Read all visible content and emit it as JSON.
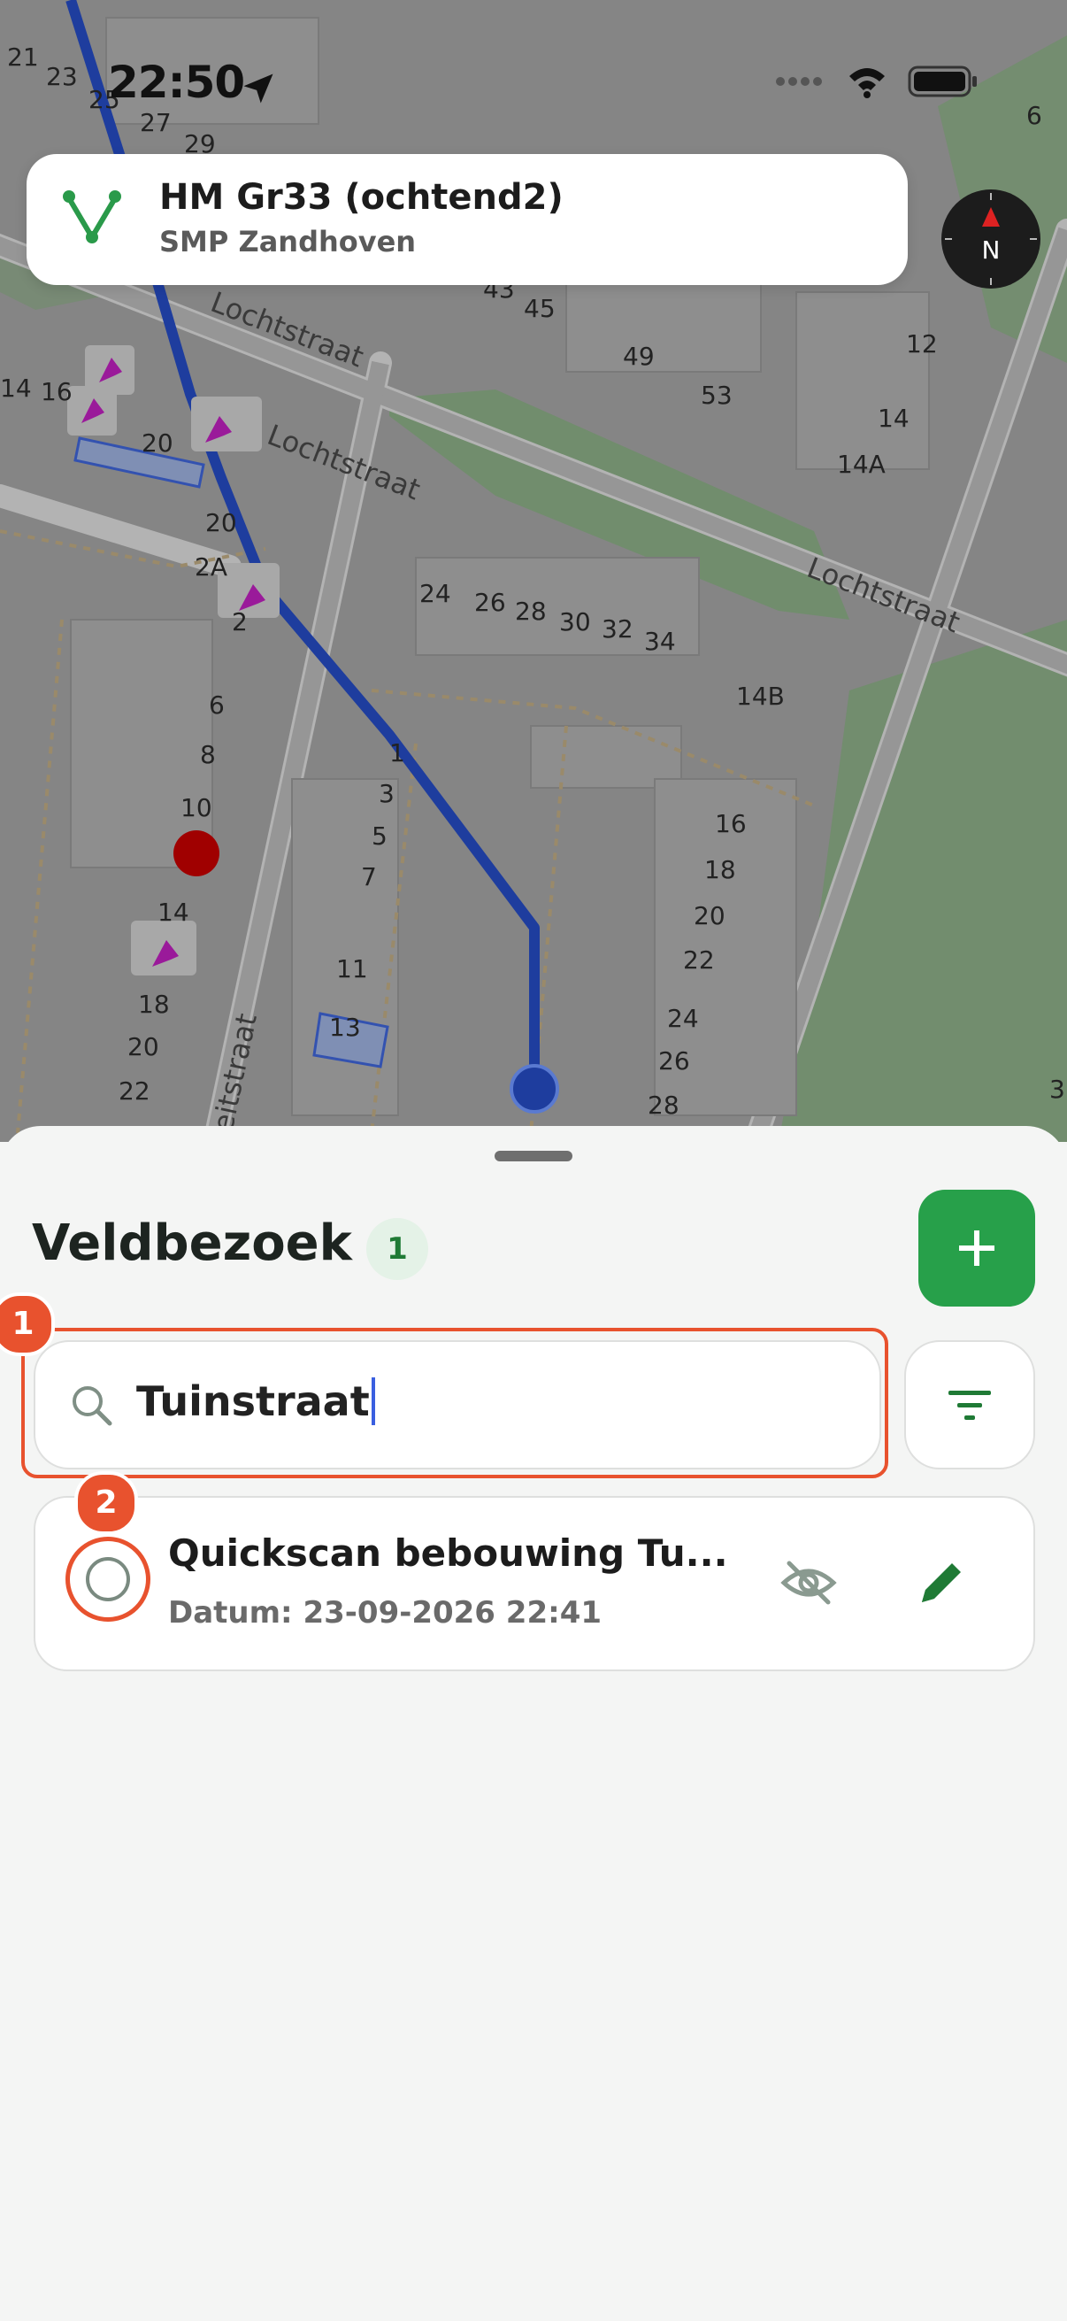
{
  "status": {
    "time": "22:50"
  },
  "route": {
    "title": "HM Gr33 (ochtend2)",
    "subtitle": "SMP Zandhoven"
  },
  "compass": {
    "letter": "N"
  },
  "map": {
    "house_numbers": [
      "21",
      "23",
      "25",
      "27",
      "29",
      "6",
      "43",
      "45",
      "49",
      "53",
      "12",
      "14",
      "14A",
      "14",
      "16",
      "20",
      "20",
      "2A",
      "2",
      "24",
      "26",
      "28",
      "30",
      "32",
      "34",
      "14B",
      "6",
      "8",
      "10",
      "1",
      "3",
      "5",
      "7",
      "16",
      "18",
      "20",
      "22",
      "14",
      "18",
      "20",
      "22",
      "11",
      "13",
      "24",
      "26",
      "28",
      "3"
    ],
    "streets": [
      "Lochtstraat",
      "Lochtstraat",
      "Lochtstraat",
      "eitstraat"
    ]
  },
  "sheet": {
    "title": "Veldbezoek",
    "count": "1"
  },
  "search": {
    "value": "Tuinstraat",
    "placeholder": ""
  },
  "markers": {
    "first": "1",
    "second": "2"
  },
  "items": [
    {
      "title": "Quickscan bebouwing Tu...",
      "date": "Datum: 23-09-2026 22:41"
    }
  ]
}
